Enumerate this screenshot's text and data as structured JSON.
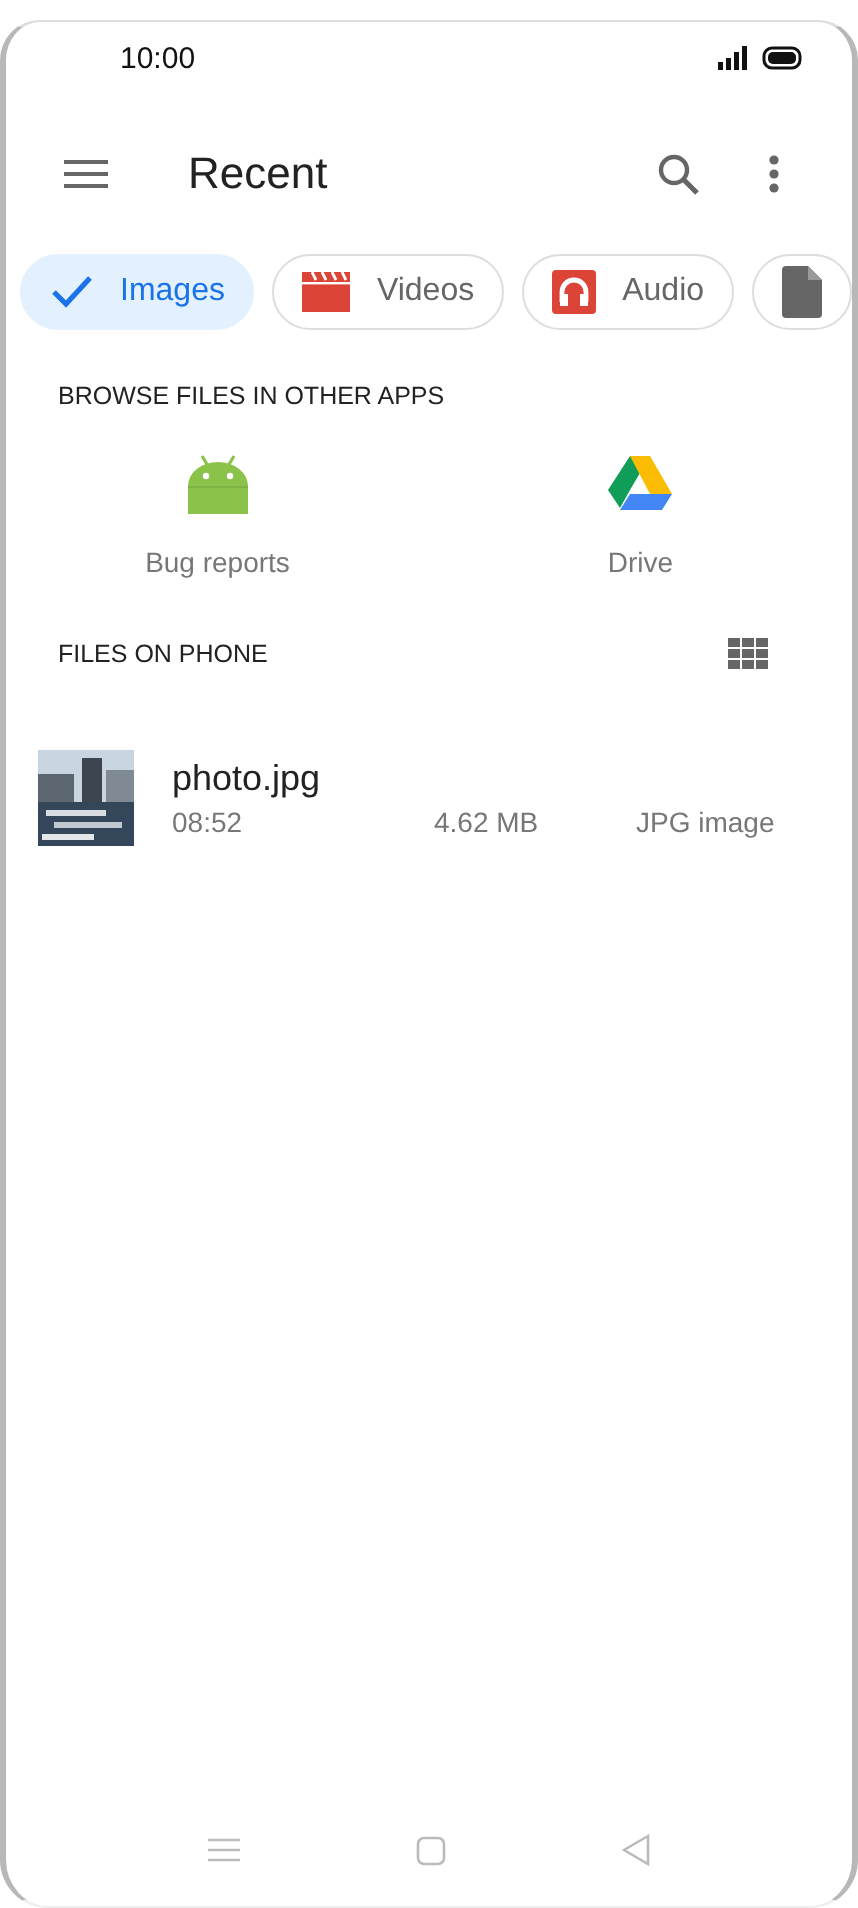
{
  "status_bar": {
    "time": "10:00"
  },
  "app_bar": {
    "title": "Recent"
  },
  "chips": [
    {
      "kind": "images",
      "label": "Images",
      "selected": true
    },
    {
      "kind": "videos",
      "label": "Videos",
      "selected": false
    },
    {
      "kind": "audio",
      "label": "Audio",
      "selected": false
    },
    {
      "kind": "documents",
      "selected": false
    }
  ],
  "browse_section": {
    "heading": "BROWSE FILES IN OTHER APPS",
    "apps": [
      {
        "kind": "android",
        "label": "Bug reports"
      },
      {
        "kind": "drive",
        "label": "Drive"
      }
    ]
  },
  "files_section": {
    "heading": "FILES ON PHONE",
    "files": [
      {
        "kind": "picture",
        "name": "photo.jpg",
        "time": "08:52",
        "size": "4.62 MB",
        "type": "JPG image"
      }
    ]
  }
}
